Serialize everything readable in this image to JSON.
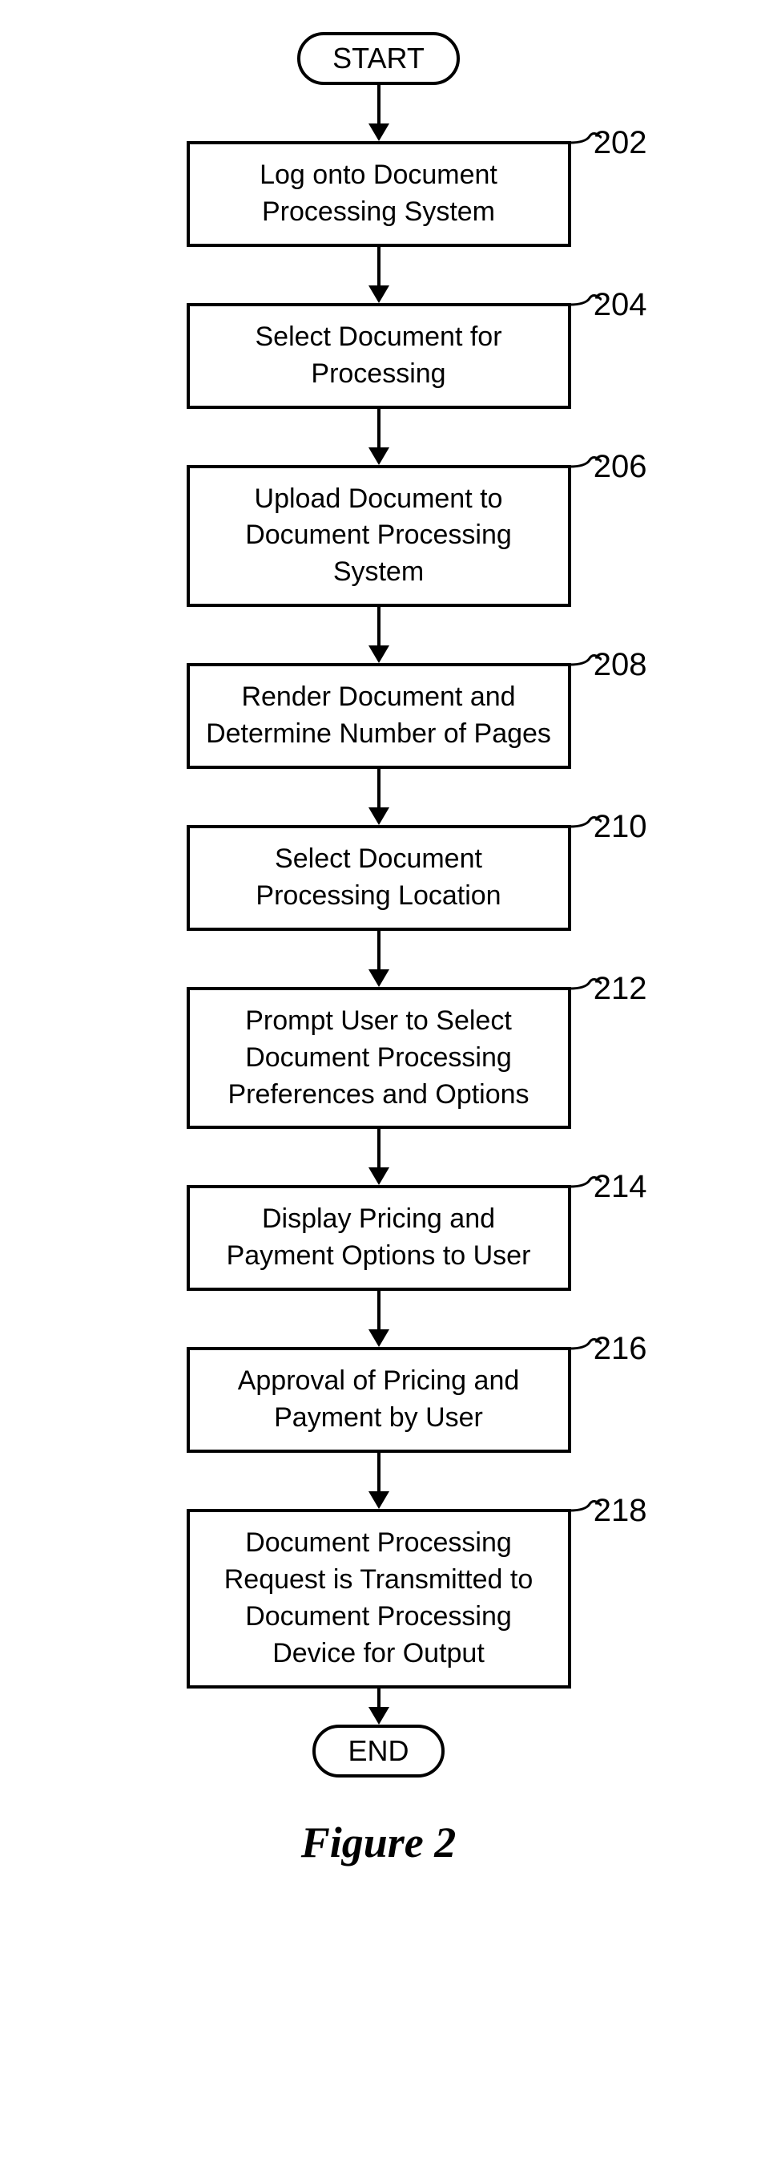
{
  "start": "START",
  "end": "END",
  "figure_label": "Figure 2",
  "steps": [
    {
      "num": "202",
      "text": "Log onto Document Processing System"
    },
    {
      "num": "204",
      "text": "Select Document for Processing"
    },
    {
      "num": "206",
      "text": "Upload Document to Document Processing System"
    },
    {
      "num": "208",
      "text": "Render Document and Determine Number of Pages"
    },
    {
      "num": "210",
      "text": "Select Document Processing Location"
    },
    {
      "num": "212",
      "text": "Prompt User to Select Document Processing Preferences and Options"
    },
    {
      "num": "214",
      "text": "Display Pricing and Payment Options to User"
    },
    {
      "num": "216",
      "text": "Approval of Pricing and Payment by User"
    },
    {
      "num": "218",
      "text": "Document Processing Request is Transmitted to Document Processing Device for Output"
    }
  ]
}
